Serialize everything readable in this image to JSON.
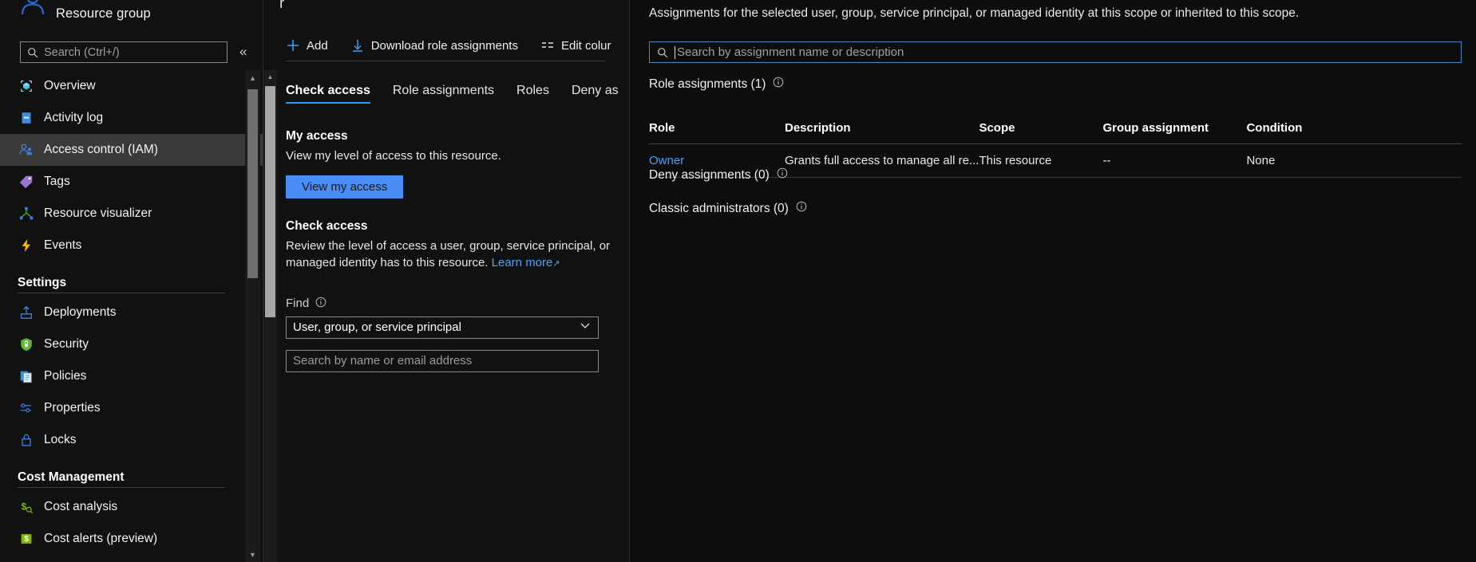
{
  "sidebar": {
    "resource_type": "Resource group",
    "search": {
      "placeholder": "Search (Ctrl+/)",
      "icon": "search-icon"
    },
    "collapse_icon": "chevron-double-left-icon",
    "items": [
      {
        "label": "Overview",
        "icon": "overview-cube-icon",
        "selected": false
      },
      {
        "label": "Activity log",
        "icon": "activity-log-icon",
        "selected": false
      },
      {
        "label": "Access control (IAM)",
        "icon": "access-control-icon",
        "selected": true
      },
      {
        "label": "Tags",
        "icon": "tag-icon",
        "selected": false
      },
      {
        "label": "Resource visualizer",
        "icon": "resource-visualizer-icon",
        "selected": false
      },
      {
        "label": "Events",
        "icon": "events-lightning-icon",
        "selected": false
      }
    ],
    "groups": [
      {
        "title": "Settings",
        "items": [
          {
            "label": "Deployments",
            "icon": "deployments-upload-icon"
          },
          {
            "label": "Security",
            "icon": "security-shield-icon"
          },
          {
            "label": "Policies",
            "icon": "policies-documents-icon"
          },
          {
            "label": "Properties",
            "icon": "properties-sliders-icon"
          },
          {
            "label": "Locks",
            "icon": "lock-icon"
          }
        ]
      },
      {
        "title": "Cost Management",
        "items": [
          {
            "label": "Cost analysis",
            "icon": "cost-analysis-icon"
          },
          {
            "label": "Cost alerts (preview)",
            "icon": "cost-alerts-icon"
          }
        ]
      }
    ]
  },
  "content": {
    "breadcrumb_tail": "r",
    "breadcrumb_paren_left": "(",
    "breadcrumb_paren_right": ")",
    "toolbar": [
      {
        "label": "Add",
        "icon": "plus-icon"
      },
      {
        "label": "Download role assignments",
        "icon": "download-icon"
      },
      {
        "label": "Edit colur",
        "icon": "edit-columns-icon"
      }
    ],
    "tabs": [
      {
        "label": "Check access",
        "active": true
      },
      {
        "label": "Role assignments",
        "active": false
      },
      {
        "label": "Roles",
        "active": false
      },
      {
        "label": "Deny as",
        "active": false
      }
    ],
    "my_access": {
      "title": "My access",
      "text": "View my level of access to this resource.",
      "button": "View my access"
    },
    "check_access": {
      "title": "Check access",
      "text_line1": "Review the level of access a user, group, service principal, or",
      "text_line2": "managed identity has to this resource.",
      "learn_more": "Learn more",
      "external_icon": "external-link-icon"
    },
    "find": {
      "label": "Find",
      "info_icon": "info-icon",
      "selected_option": "User, group, or service principal",
      "chevron_icon": "chevron-down-icon",
      "search_placeholder": "Search by name or email address"
    }
  },
  "overlay": {
    "description": "Assignments for the selected user, group, service principal, or managed identity at this scope or inherited to this scope.",
    "search": {
      "placeholder": "Search by assignment name or description",
      "icon": "search-icon"
    },
    "role_assignments": {
      "heading": "Role assignments (1)",
      "info_icon": "info-icon",
      "columns": [
        "Role",
        "Description",
        "Scope",
        "Group assignment",
        "Condition"
      ],
      "rows": [
        {
          "role": "Owner",
          "description": "Grants full access to manage all re...",
          "scope": "This resource",
          "group_assignment": "--",
          "condition": "None"
        }
      ]
    },
    "deny_assignments": {
      "heading": "Deny assignments (0)",
      "info_icon": "info-icon"
    },
    "classic_administrators": {
      "heading": "Classic administrators (0)",
      "info_icon": "info-icon"
    }
  },
  "colors": {
    "background": "#111111",
    "overlay_background": "#0d0d0d",
    "accent_blue": "#2899f5",
    "link_blue": "#4da3ff",
    "primary_button": "#4a8ef5",
    "selected_nav": "#3b3a39"
  }
}
